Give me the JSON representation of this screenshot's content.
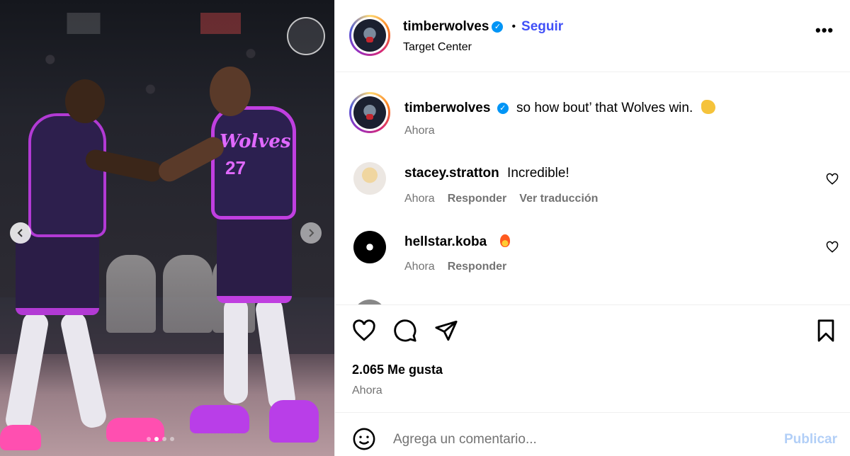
{
  "photo": {
    "jersey_text": "Wolves",
    "jersey_number": "27",
    "prev_icon": "chevron-left-icon",
    "next_icon": "chevron-right-icon",
    "carousel_dots": 4,
    "active_dot": 2
  },
  "header": {
    "username": "timberwolves",
    "verified": "✓",
    "separator": "•",
    "follow_label": "Seguir",
    "location": "Target Center",
    "more_icon": "more-options-icon",
    "more_label": "•••"
  },
  "caption": {
    "username": "timberwolves",
    "text": "so how bout’ that Wolves win.",
    "emoji": "clapping-hands-emoji",
    "time": "Ahora"
  },
  "comments": [
    {
      "username": "stacey.stratton",
      "text": "Incredible!",
      "time": "Ahora",
      "reply_label": "Responder",
      "translate_label": "Ver traducción"
    },
    {
      "username": "hellstar.koba",
      "text": "",
      "emoji": "fire-emoji",
      "time": "Ahora",
      "reply_label": "Responder"
    }
  ],
  "actions": {
    "like_icon": "heart-icon",
    "comment_icon": "comment-icon",
    "share_icon": "send-icon",
    "save_icon": "bookmark-icon"
  },
  "likes": "2.065 Me gusta",
  "posted": "Ahora",
  "composer": {
    "emoji_icon": "smiley-icon",
    "placeholder": "Agrega un comentario...",
    "publish_label": "Publicar"
  },
  "colors": {
    "accent": "#4150f7",
    "verified": "#0095f6",
    "muted": "#737373",
    "publish_disabled": "#b2cff7"
  }
}
